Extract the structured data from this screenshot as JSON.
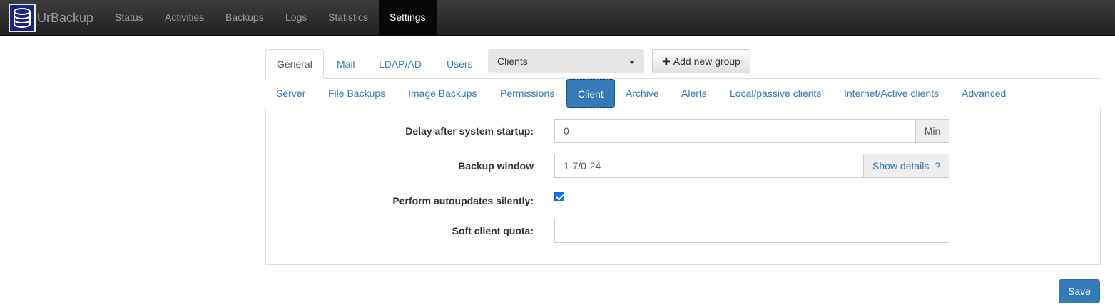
{
  "app": {
    "brand": "UrBackup"
  },
  "nav": {
    "items": [
      {
        "label": "Status"
      },
      {
        "label": "Activities"
      },
      {
        "label": "Backups"
      },
      {
        "label": "Logs"
      },
      {
        "label": "Statistics"
      },
      {
        "label": "Settings",
        "active": true
      }
    ]
  },
  "top_tabs": [
    {
      "label": "General",
      "active": true
    },
    {
      "label": "Mail"
    },
    {
      "label": "LDAP/AD"
    },
    {
      "label": "Users"
    }
  ],
  "group_select": {
    "value": "Clients"
  },
  "add_group": {
    "label": "Add new group"
  },
  "sub_tabs": [
    {
      "label": "Server"
    },
    {
      "label": "File Backups"
    },
    {
      "label": "Image Backups"
    },
    {
      "label": "Permissions"
    },
    {
      "label": "Client",
      "active": true
    },
    {
      "label": "Archive"
    },
    {
      "label": "Alerts"
    },
    {
      "label": "Local/passive clients"
    },
    {
      "label": "Internet/Active clients"
    },
    {
      "label": "Advanced"
    }
  ],
  "form": {
    "delay": {
      "label": "Delay after system startup:",
      "value": "0",
      "unit": "Min"
    },
    "backup_window": {
      "label": "Backup window",
      "value": "1-7/0-24",
      "details": "Show details  ?"
    },
    "autoupdate": {
      "label": "Perform autoupdates silently:",
      "checked": true
    },
    "soft_quota": {
      "label": "Soft client quota:",
      "value": ""
    }
  },
  "save": {
    "label": "Save"
  },
  "colors": {
    "accent": "#337ab7",
    "navbar": "#222222"
  }
}
